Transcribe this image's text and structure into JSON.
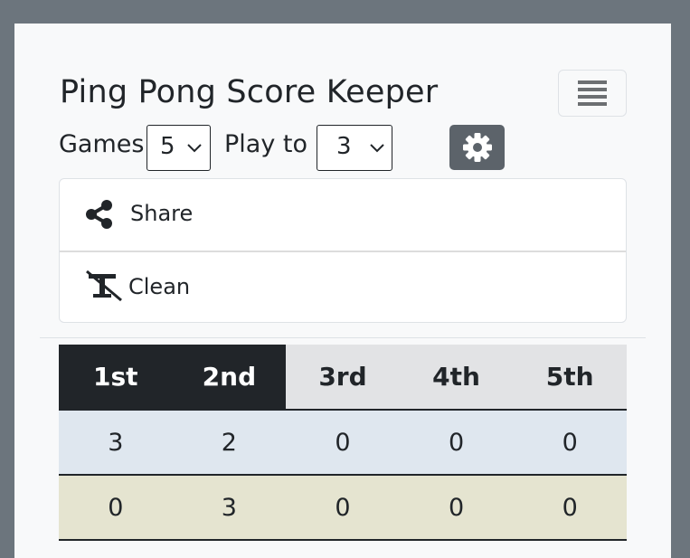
{
  "app": {
    "title": "Ping Pong Score Keeper"
  },
  "menu": {
    "icon": "hamburger-icon"
  },
  "settings": {
    "games_label": "Games",
    "games_value": "5",
    "play_to_label": "Play to",
    "play_to_value": "3",
    "settings_icon": "gear-icon",
    "settings_button_color": "#5c636a"
  },
  "dropdown": {
    "items": [
      {
        "label": "Share",
        "icon": "share-icon"
      },
      {
        "label": "Clean",
        "icon": "clear-format-icon"
      }
    ]
  },
  "table": {
    "headers": [
      "1st",
      "2nd",
      "3rd",
      "4th",
      "5th"
    ],
    "header_state": [
      "won",
      "won",
      "pending",
      "pending",
      "pending"
    ],
    "rows": [
      {
        "cells": [
          "3",
          "2",
          "0",
          "0",
          "0"
        ],
        "color": "#dfe7ef"
      },
      {
        "cells": [
          "0",
          "3",
          "0",
          "0",
          "0"
        ],
        "color": "#e5e4d0"
      }
    ]
  },
  "colors": {
    "page_background": "#6c757d",
    "card_background": "#f8f9fa",
    "header_won": "#212529",
    "header_pending": "#e2e3e5"
  }
}
